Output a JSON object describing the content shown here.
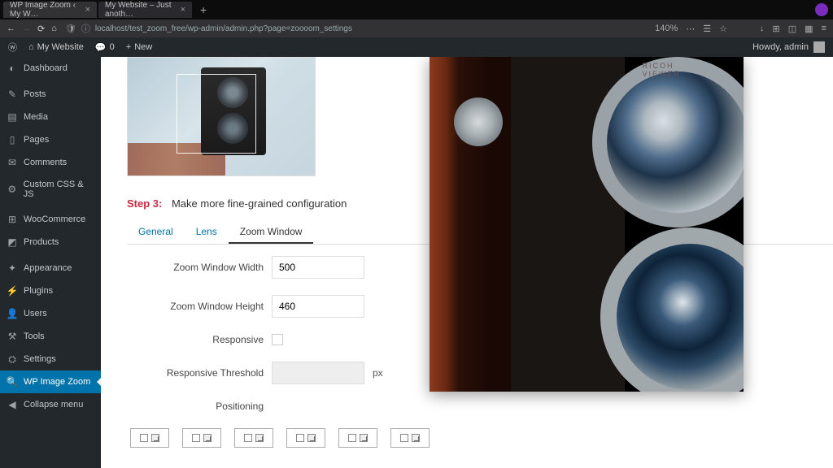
{
  "browser": {
    "tabs": [
      {
        "title": "WP Image Zoom ‹ My W…"
      },
      {
        "title": "My Website – Just anoth…"
      }
    ],
    "url": "localhost/test_zoom_free/wp-admin/admin.php?page=zoooom_settings",
    "zoom": "140%"
  },
  "wp_bar": {
    "site": "My Website",
    "comments": "0",
    "new": "New",
    "howdy": "Howdy, admin"
  },
  "sidebar": {
    "items": [
      {
        "icon": "◐",
        "label": "Dashboard"
      },
      {
        "icon": "✎",
        "label": "Posts"
      },
      {
        "icon": "▤",
        "label": "Media"
      },
      {
        "icon": "▯",
        "label": "Pages"
      },
      {
        "icon": "✉",
        "label": "Comments"
      },
      {
        "icon": "⚙",
        "label": "Custom CSS & JS"
      },
      {
        "icon": "⊞",
        "label": "WooCommerce"
      },
      {
        "icon": "◩",
        "label": "Products"
      },
      {
        "icon": "✦",
        "label": "Appearance"
      },
      {
        "icon": "⚡",
        "label": "Plugins"
      },
      {
        "icon": "👤",
        "label": "Users"
      },
      {
        "icon": "⚒",
        "label": "Tools"
      },
      {
        "icon": "⛭",
        "label": "Settings"
      },
      {
        "icon": "🔍",
        "label": "WP Image Zoom"
      },
      {
        "icon": "◀",
        "label": "Collapse menu"
      }
    ]
  },
  "page": {
    "step_label": "Step 3:",
    "step_text": "Make more fine-grained configuration",
    "tabs": [
      "General",
      "Lens",
      "Zoom Window"
    ],
    "fields": {
      "width_label": "Zoom Window Width",
      "width_value": "500",
      "height_label": "Zoom Window Height",
      "height_value": "460",
      "responsive_label": "Responsive",
      "threshold_label": "Responsive Threshold",
      "threshold_value": "",
      "threshold_unit": "px",
      "positioning_label": "Positioning"
    }
  }
}
